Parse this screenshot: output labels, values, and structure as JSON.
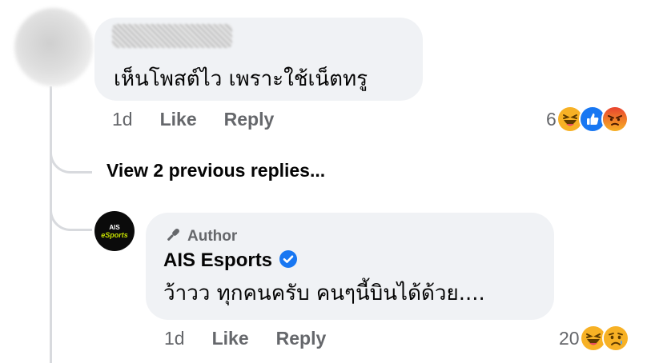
{
  "comment": {
    "text": "เห็นโพสต์ไว เพราะใช้เน็ตทรู",
    "time": "1d",
    "like_label": "Like",
    "reply_label": "Reply",
    "reaction_count": "6",
    "reactions": [
      "haha-icon",
      "like-icon",
      "angry-icon"
    ]
  },
  "view_previous": "View 2 previous replies...",
  "reply": {
    "author_badge": "Author",
    "page_name": "AIS Esports",
    "avatar_text_top": "AIS",
    "avatar_text_bottom": "eSports",
    "text": "ว้าวว ทุกคนครับ คนๆนี้บินได้ด้วย....",
    "time": "1d",
    "like_label": "Like",
    "reply_label": "Reply",
    "reaction_count": "20",
    "reactions": [
      "haha-icon",
      "sad-icon"
    ]
  },
  "colors": {
    "bubble": "#f0f2f5",
    "secondary_text": "#65676b",
    "verified_blue": "#1877f2",
    "thread_line": "#d8dade"
  }
}
